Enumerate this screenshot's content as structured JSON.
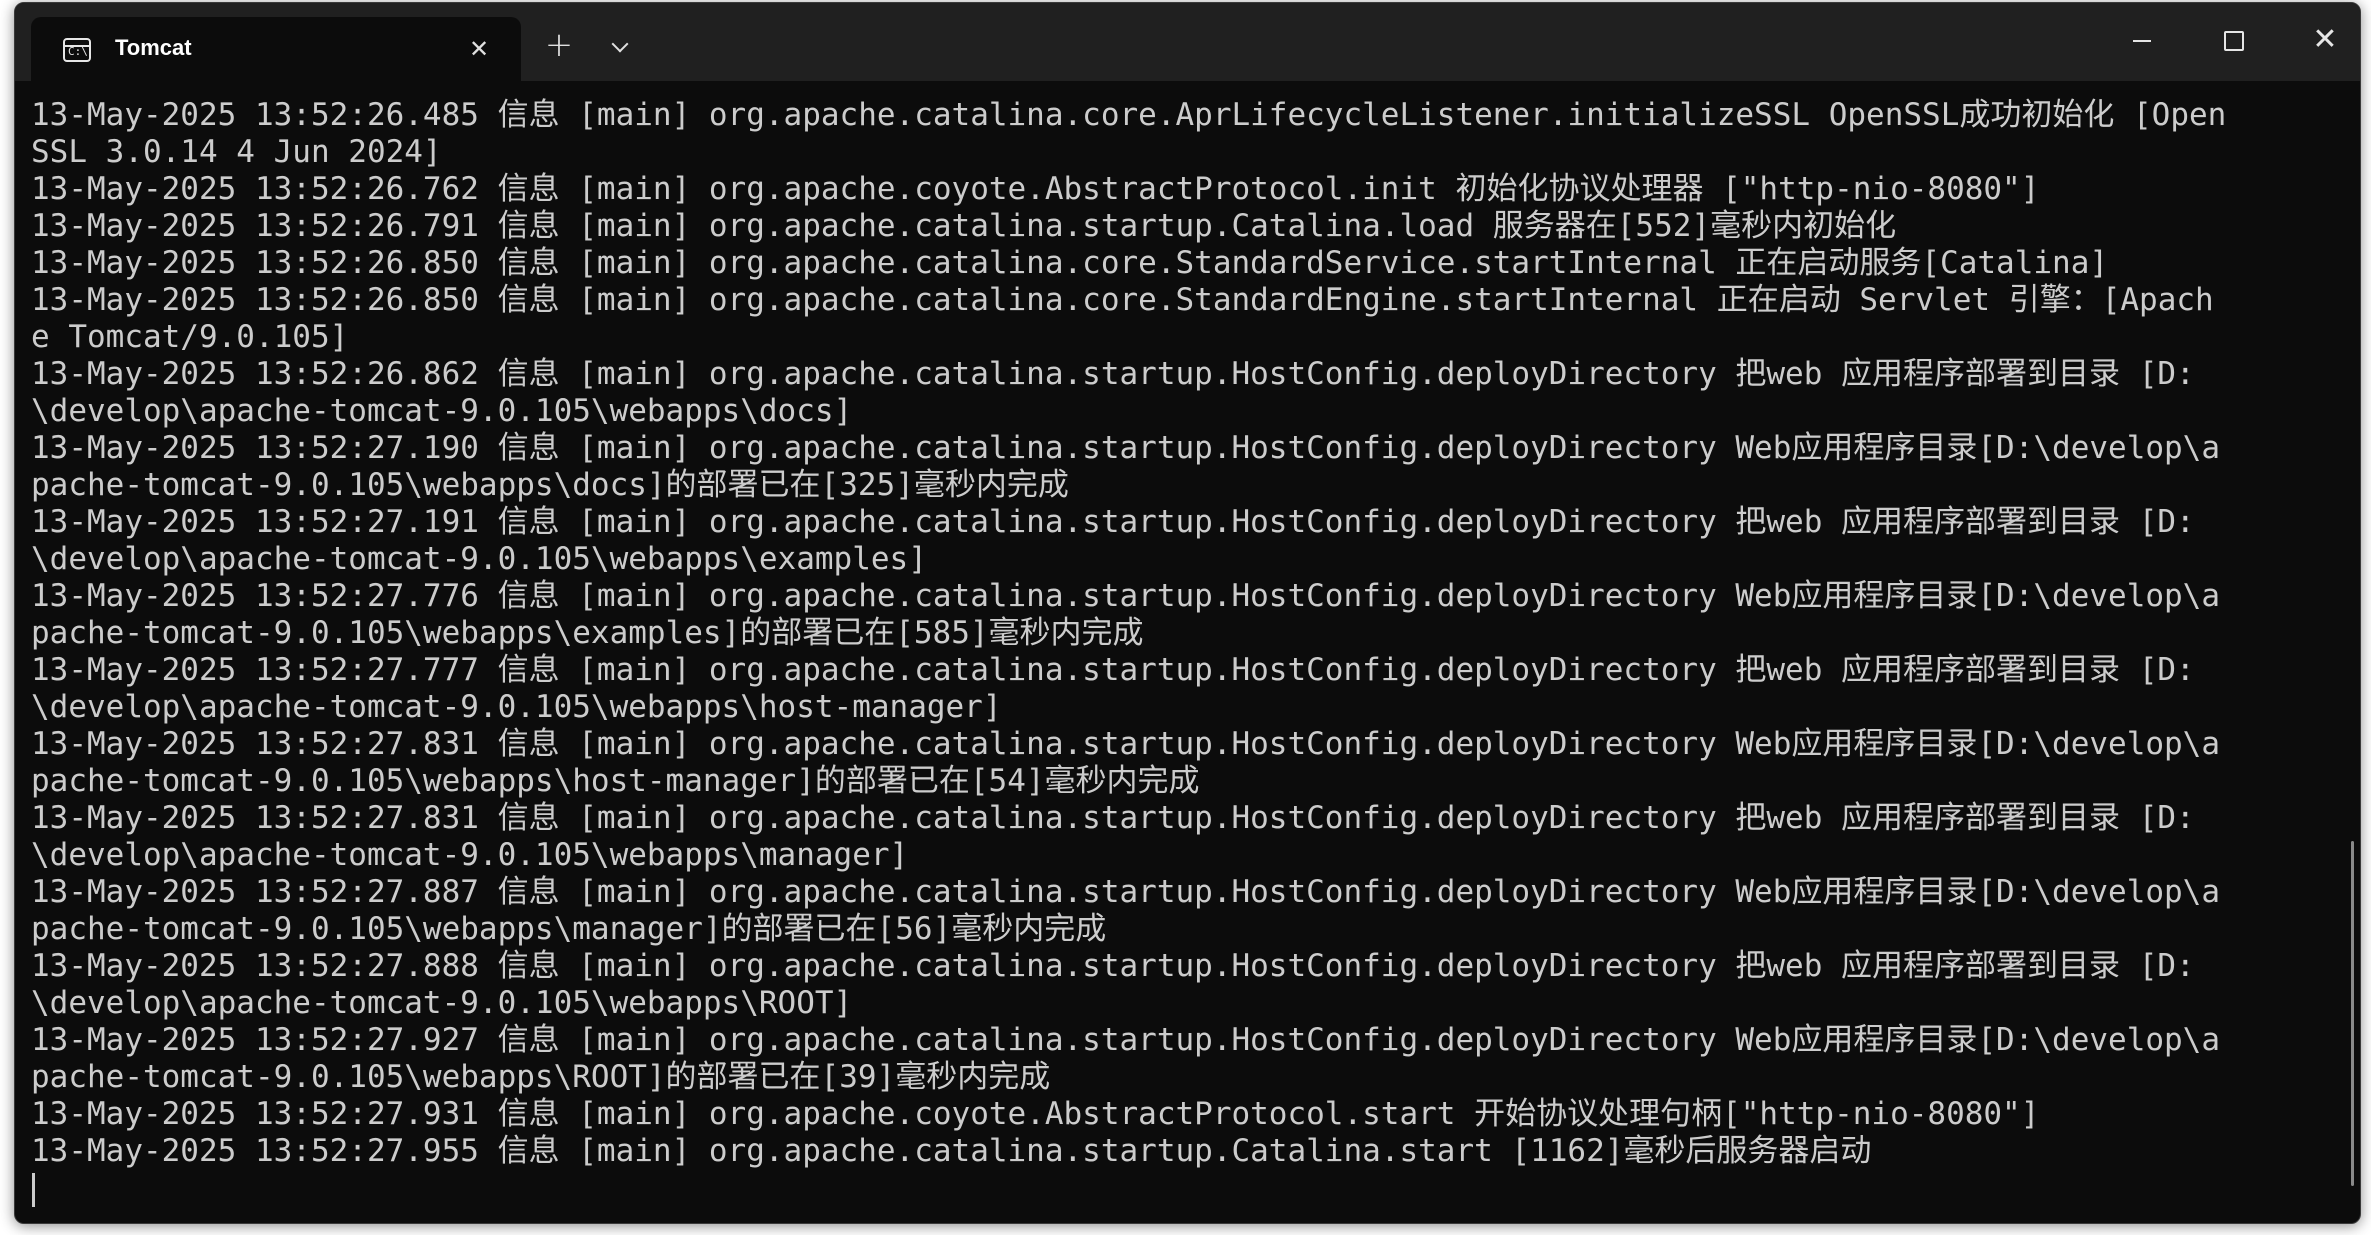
{
  "window": {
    "tab_title": "Tomcat",
    "tab_icon": "terminal-icon",
    "tab_icon_glyph": "C:\\",
    "close_tab_glyph": "✕",
    "new_tab_glyph": "+",
    "minimize_icon": "minimize-icon",
    "maximize_icon": "maximize-icon",
    "close_window_glyph": "✕"
  },
  "colors": {
    "terminal_bg": "#0c0c0c",
    "titlebar_bg": "#202020",
    "text": "#cccccc"
  },
  "terminal": {
    "lines": [
      "13-May-2025 13:52:26.485 信息 [main] org.apache.catalina.core.AprLifecycleListener.initializeSSL OpenSSL成功初始化 [Open",
      "SSL 3.0.14 4 Jun 2024]",
      "13-May-2025 13:52:26.762 信息 [main] org.apache.coyote.AbstractProtocol.init 初始化协议处理器 [\"http-nio-8080\"]",
      "13-May-2025 13:52:26.791 信息 [main] org.apache.catalina.startup.Catalina.load 服务器在[552]毫秒内初始化",
      "13-May-2025 13:52:26.850 信息 [main] org.apache.catalina.core.StandardService.startInternal 正在启动服务[Catalina]",
      "13-May-2025 13:52:26.850 信息 [main] org.apache.catalina.core.StandardEngine.startInternal 正在启动 Servlet 引擎：[Apach",
      "e Tomcat/9.0.105]",
      "13-May-2025 13:52:26.862 信息 [main] org.apache.catalina.startup.HostConfig.deployDirectory 把web 应用程序部署到目录 [D:",
      "\\develop\\apache-tomcat-9.0.105\\webapps\\docs]",
      "13-May-2025 13:52:27.190 信息 [main] org.apache.catalina.startup.HostConfig.deployDirectory Web应用程序目录[D:\\develop\\a",
      "pache-tomcat-9.0.105\\webapps\\docs]的部署已在[325]毫秒内完成",
      "13-May-2025 13:52:27.191 信息 [main] org.apache.catalina.startup.HostConfig.deployDirectory 把web 应用程序部署到目录 [D:",
      "\\develop\\apache-tomcat-9.0.105\\webapps\\examples]",
      "13-May-2025 13:52:27.776 信息 [main] org.apache.catalina.startup.HostConfig.deployDirectory Web应用程序目录[D:\\develop\\a",
      "pache-tomcat-9.0.105\\webapps\\examples]的部署已在[585]毫秒内完成",
      "13-May-2025 13:52:27.777 信息 [main] org.apache.catalina.startup.HostConfig.deployDirectory 把web 应用程序部署到目录 [D:",
      "\\develop\\apache-tomcat-9.0.105\\webapps\\host-manager]",
      "13-May-2025 13:52:27.831 信息 [main] org.apache.catalina.startup.HostConfig.deployDirectory Web应用程序目录[D:\\develop\\a",
      "pache-tomcat-9.0.105\\webapps\\host-manager]的部署已在[54]毫秒内完成",
      "13-May-2025 13:52:27.831 信息 [main] org.apache.catalina.startup.HostConfig.deployDirectory 把web 应用程序部署到目录 [D:",
      "\\develop\\apache-tomcat-9.0.105\\webapps\\manager]",
      "13-May-2025 13:52:27.887 信息 [main] org.apache.catalina.startup.HostConfig.deployDirectory Web应用程序目录[D:\\develop\\a",
      "pache-tomcat-9.0.105\\webapps\\manager]的部署已在[56]毫秒内完成",
      "13-May-2025 13:52:27.888 信息 [main] org.apache.catalina.startup.HostConfig.deployDirectory 把web 应用程序部署到目录 [D:",
      "\\develop\\apache-tomcat-9.0.105\\webapps\\ROOT]",
      "13-May-2025 13:52:27.927 信息 [main] org.apache.catalina.startup.HostConfig.deployDirectory Web应用程序目录[D:\\develop\\a",
      "pache-tomcat-9.0.105\\webapps\\ROOT]的部署已在[39]毫秒内完成",
      "13-May-2025 13:52:27.931 信息 [main] org.apache.coyote.AbstractProtocol.start 开始协议处理句柄[\"http-nio-8080\"]",
      "13-May-2025 13:52:27.955 信息 [main] org.apache.catalina.startup.Catalina.start [1162]毫秒后服务器启动"
    ]
  }
}
